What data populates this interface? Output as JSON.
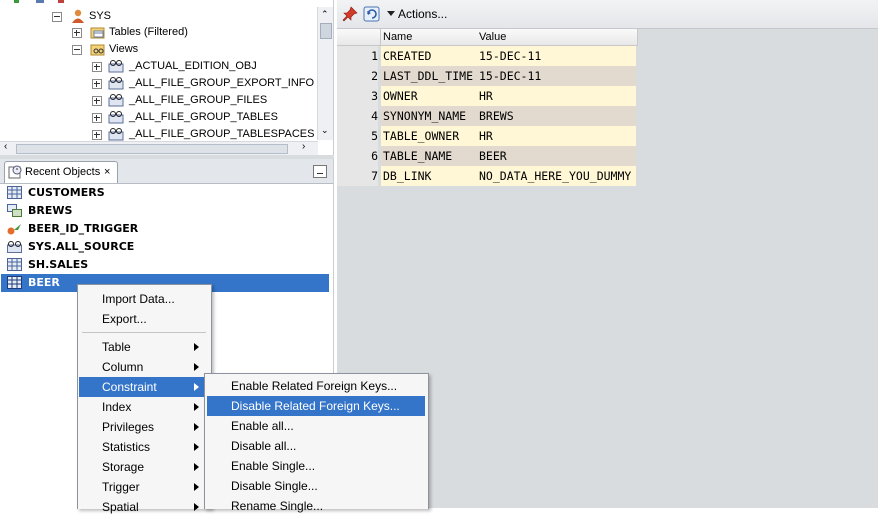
{
  "tree": {
    "nodes": [
      {
        "label": "SYS",
        "icon": "user-schema-icon"
      },
      {
        "label": "Tables (Filtered)",
        "icon": "tables-folder-icon"
      },
      {
        "label": "Views",
        "icon": "views-folder-icon"
      },
      {
        "label": "_ACTUAL_EDITION_OBJ",
        "icon": "view-icon"
      },
      {
        "label": "_ALL_FILE_GROUP_EXPORT_INFO",
        "icon": "view-icon"
      },
      {
        "label": "_ALL_FILE_GROUP_FILES",
        "icon": "view-icon"
      },
      {
        "label": "_ALL_FILE_GROUP_TABLES",
        "icon": "view-icon"
      },
      {
        "label": "_ALL_FILE_GROUP_TABLESPACES",
        "icon": "view-icon"
      }
    ]
  },
  "recent": {
    "tab_label": "Recent Objects",
    "items": [
      {
        "label": "CUSTOMERS",
        "icon": "table-icon"
      },
      {
        "label": "BREWS",
        "icon": "synonym-icon"
      },
      {
        "label": "BEER_ID_TRIGGER",
        "icon": "trigger-icon"
      },
      {
        "label": "SYS.ALL_SOURCE",
        "icon": "view-icon"
      },
      {
        "label": "SH.SALES",
        "icon": "table-icon"
      },
      {
        "label": "BEER",
        "icon": "table-icon"
      }
    ],
    "selected_index": 5
  },
  "toolbar": {
    "actions_label": "Actions..."
  },
  "grid": {
    "headers": [
      "Name",
      "Value"
    ],
    "rows": [
      {
        "num": "1",
        "name": "CREATED",
        "value": "15-DEC-11"
      },
      {
        "num": "2",
        "name": "LAST_DDL_TIME",
        "value": "15-DEC-11"
      },
      {
        "num": "3",
        "name": "OWNER",
        "value": "HR"
      },
      {
        "num": "4",
        "name": "SYNONYM_NAME",
        "value": "BREWS"
      },
      {
        "num": "5",
        "name": "TABLE_OWNER",
        "value": "HR"
      },
      {
        "num": "6",
        "name": "TABLE_NAME",
        "value": "BEER"
      },
      {
        "num": "7",
        "name": "DB_LINK",
        "value": "NO_DATA_HERE_YOU_DUMMY"
      }
    ]
  },
  "context_menu": {
    "items": [
      {
        "label": "Import Data...",
        "submenu": false
      },
      {
        "label": "Export...",
        "submenu": false
      },
      {
        "separator": true
      },
      {
        "label": "Table",
        "submenu": true
      },
      {
        "label": "Column",
        "submenu": true
      },
      {
        "label": "Constraint",
        "submenu": true,
        "active": true
      },
      {
        "label": "Index",
        "submenu": true
      },
      {
        "label": "Privileges",
        "submenu": true
      },
      {
        "label": "Statistics",
        "submenu": true
      },
      {
        "label": "Storage",
        "submenu": true
      },
      {
        "label": "Trigger",
        "submenu": true
      },
      {
        "label": "Spatial",
        "submenu": true
      }
    ]
  },
  "submenu": {
    "items": [
      {
        "label": "Enable Related Foreign Keys...",
        "active": false
      },
      {
        "label": "Disable Related Foreign Keys...",
        "active": true
      },
      {
        "label": "Enable all...",
        "active": false
      },
      {
        "label": "Disable all...",
        "active": false
      },
      {
        "label": "Enable Single...",
        "active": false
      },
      {
        "label": "Disable Single...",
        "active": false
      },
      {
        "label": "Rename Single...",
        "active": false
      }
    ]
  },
  "colors": {
    "selection": "#3474c9",
    "grid_row_light": "#fff7d6",
    "grid_row_dark": "#e2d9cf"
  }
}
